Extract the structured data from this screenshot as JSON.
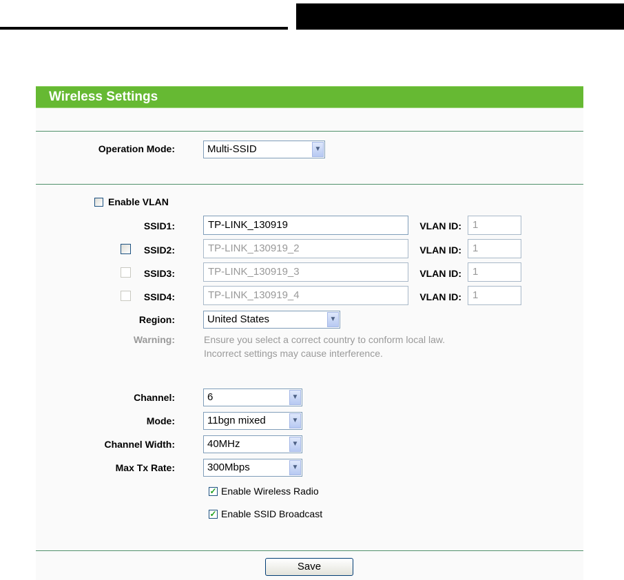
{
  "title": "Wireless Settings",
  "operation_mode": {
    "label": "Operation Mode:",
    "value": "Multi-SSID"
  },
  "enable_vlan": {
    "label": "Enable VLAN",
    "checked": false
  },
  "ssids": [
    {
      "label": "SSID1:",
      "value": "TP-LINK_130919",
      "vlan_label": "VLAN ID:",
      "vlan_id": "1"
    },
    {
      "label": "SSID2:",
      "value": "TP-LINK_130919_2",
      "vlan_label": "VLAN ID:",
      "vlan_id": "1",
      "checked": false
    },
    {
      "label": "SSID3:",
      "value": "TP-LINK_130919_3",
      "vlan_label": "VLAN ID:",
      "vlan_id": "1",
      "checked": false
    },
    {
      "label": "SSID4:",
      "value": "TP-LINK_130919_4",
      "vlan_label": "VLAN ID:",
      "vlan_id": "1",
      "checked": false
    }
  ],
  "region": {
    "label": "Region:",
    "value": "United States"
  },
  "warning": {
    "label": "Warning:",
    "line1": "Ensure you select a correct country to conform local law.",
    "line2": "Incorrect settings may cause interference."
  },
  "channel": {
    "label": "Channel:",
    "value": "6"
  },
  "mode": {
    "label": "Mode:",
    "value": "11bgn mixed"
  },
  "channel_width": {
    "label": "Channel Width:",
    "value": "40MHz"
  },
  "max_tx_rate": {
    "label": "Max Tx Rate:",
    "value": "300Mbps"
  },
  "enable_wireless_radio": {
    "label": "Enable Wireless Radio",
    "checked": true
  },
  "enable_ssid_broadcast": {
    "label": "Enable SSID Broadcast",
    "checked": true
  },
  "save_label": "Save",
  "colors": {
    "header": "#66b933",
    "separator": "#4f8f6a"
  }
}
